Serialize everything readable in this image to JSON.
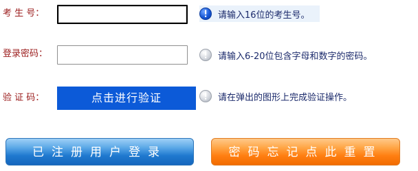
{
  "form": {
    "exam_no": {
      "label": "考 生 号：",
      "value": "",
      "hint": "请输入16位的考生号。"
    },
    "password": {
      "label": "登录密码：",
      "value": "",
      "hint": "请输入6-20位包含字母和数字的密码。"
    },
    "captcha": {
      "label": "验 证 码：",
      "button_label": "点击进行验证",
      "hint": "请在弹出的图形上完成验证操作。"
    }
  },
  "buttons": {
    "login_label": "已注册用户登录",
    "reset_label": "密码忘记点此重置"
  },
  "colors": {
    "label_text": "#9b1c1c",
    "hint_text": "#1b2a6b",
    "verify_button": "#0c5ad8",
    "login_button": "#1f79cf",
    "reset_button": "#ff7f12",
    "active_hint_bg": "#eaf2fb"
  },
  "icons": {
    "exam_hint": "info-icon-blue",
    "password_hint": "info-icon-gray",
    "captcha_hint": "info-icon-gray"
  }
}
